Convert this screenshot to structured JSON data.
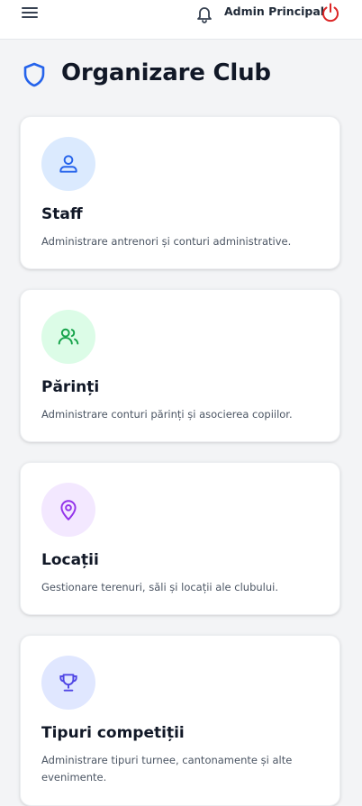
{
  "header": {
    "menu_icon": "hamburger-icon",
    "notification_icon": "bell-icon",
    "user_name": "Admin Principal",
    "logout_icon": "power-icon",
    "logout_color": "#dc2626"
  },
  "page": {
    "title": "Organizare Club",
    "title_icon": "shield-icon",
    "accent": "#2563eb"
  },
  "cards": [
    {
      "title": "Staff",
      "description": "Administrare antrenori și conturi administrative.",
      "icon": "user-icon",
      "icon_color": "#2563eb",
      "icon_bg": "#dbeafe"
    },
    {
      "title": "Părinți",
      "description": "Administrare conturi părinți și asocierea copiilor.",
      "icon": "users-icon",
      "icon_color": "#16a34a",
      "icon_bg": "#dcfce7"
    },
    {
      "title": "Locații",
      "description": "Gestionare terenuri, săli și locații ale clubului.",
      "icon": "map-pin-icon",
      "icon_color": "#9333ea",
      "icon_bg": "#f3e8ff"
    },
    {
      "title": "Tipuri competiții",
      "description": "Administrare tipuri turnee, cantonamente și alte evenimente.",
      "icon": "trophy-icon",
      "icon_color": "#4f46e5",
      "icon_bg": "#e0e7ff"
    }
  ]
}
